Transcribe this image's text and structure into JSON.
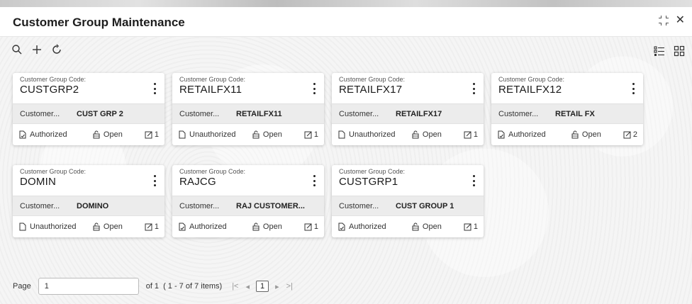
{
  "window": {
    "title": "Customer Group Maintenance"
  },
  "toolbar": {
    "icons": [
      "search-icon",
      "add-icon",
      "refresh-icon"
    ],
    "view_icons": [
      "list-view-icon",
      "tile-view-icon"
    ]
  },
  "cards": [
    {
      "code_label": "Customer Group Code:",
      "code": "CUSTGRP2",
      "desc_label": "Customer...",
      "desc": "CUST GRP 2",
      "auth": "Authorized",
      "status": "Open",
      "version": "1"
    },
    {
      "code_label": "Customer Group Code:",
      "code": "RETAILFX11",
      "desc_label": "Customer...",
      "desc": "RETAILFX11",
      "auth": "Unauthorized",
      "status": "Open",
      "version": "1"
    },
    {
      "code_label": "Customer Group Code:",
      "code": "RETAILFX17",
      "desc_label": "Customer...",
      "desc": "RETAILFX17",
      "auth": "Unauthorized",
      "status": "Open",
      "version": "1"
    },
    {
      "code_label": "Customer Group Code:",
      "code": "RETAILFX12",
      "desc_label": "Customer...",
      "desc": "RETAIL FX",
      "auth": "Authorized",
      "status": "Open",
      "version": "2"
    },
    {
      "code_label": "Customer Group Code:",
      "code": "DOMIN",
      "desc_label": "Customer...",
      "desc": "DOMINO",
      "auth": "Unauthorized",
      "status": "Open",
      "version": "1"
    },
    {
      "code_label": "Customer Group Code:",
      "code": "RAJCG",
      "desc_label": "Customer...",
      "desc": "RAJ CUSTOMER...",
      "auth": "Authorized",
      "status": "Open",
      "version": "1"
    },
    {
      "code_label": "Customer Group Code:",
      "code": "CUSTGRP1",
      "desc_label": "Customer...",
      "desc": "CUST GROUP 1",
      "auth": "Authorized",
      "status": "Open",
      "version": "1"
    }
  ],
  "pager": {
    "page_label": "Page",
    "page_value": "1",
    "of_text": "of 1",
    "items_text": "( 1 - 7 of 7 items)",
    "current_page": "1",
    "first": "|<",
    "prev": "◂",
    "next": "▸",
    "last": ">|"
  }
}
